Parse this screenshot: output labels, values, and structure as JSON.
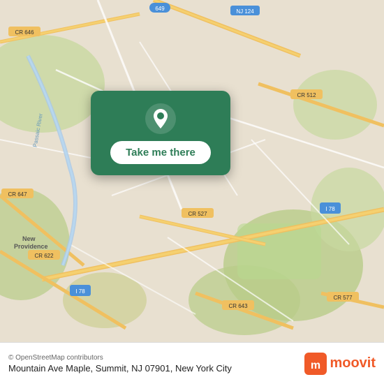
{
  "map": {
    "background_color": "#e8e0d0"
  },
  "popup": {
    "button_label": "Take me there",
    "bg_color": "#2e7d57"
  },
  "bottom_bar": {
    "osm_credit": "© OpenStreetMap contributors",
    "address": "Mountain Ave Maple, Summit, NJ 07901, New York City",
    "brand": "moovit"
  }
}
